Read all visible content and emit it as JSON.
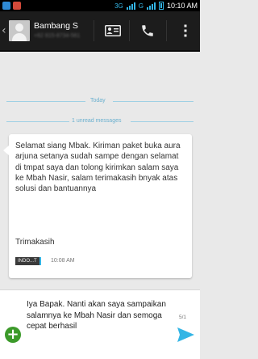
{
  "status_bar": {
    "network": "3G",
    "network2": "G",
    "time": "10:10 AM"
  },
  "header": {
    "contact_name": "Bambang S",
    "contact_number": "+62 815-8734-561",
    "icons": {
      "back": "chevron-left-icon",
      "contact": "contact-card-icon",
      "call": "phone-icon",
      "menu": "overflow-menu-icon"
    }
  },
  "conversation": {
    "date_separator": "Today",
    "unread_separator": "1 unread messages",
    "message": {
      "body": "Selamat siang Mbak. Kiriman paket buka aura arjuna setanya sudah sampe dengan selamat di tmpat saya dan tolong kirimkan salam saya ke Mbah Nasir, salam terimakasih bnyak atas solusi dan bantuannya",
      "sign": "Trimakasih",
      "sim_label": "INDO...T",
      "time": "10:08 AM"
    }
  },
  "compose": {
    "text": "Iya Bapak. Nanti akan saya sampaikan salamnya ke Mbah Nasir dan semoga cepat berhasil",
    "counter": "5/1"
  },
  "colors": {
    "accent": "#33b5e5",
    "action_bar": "#1c1c1c",
    "background": "#e9e9e9",
    "add_button": "#3c9a2a",
    "send_button": "#33b5e5"
  }
}
